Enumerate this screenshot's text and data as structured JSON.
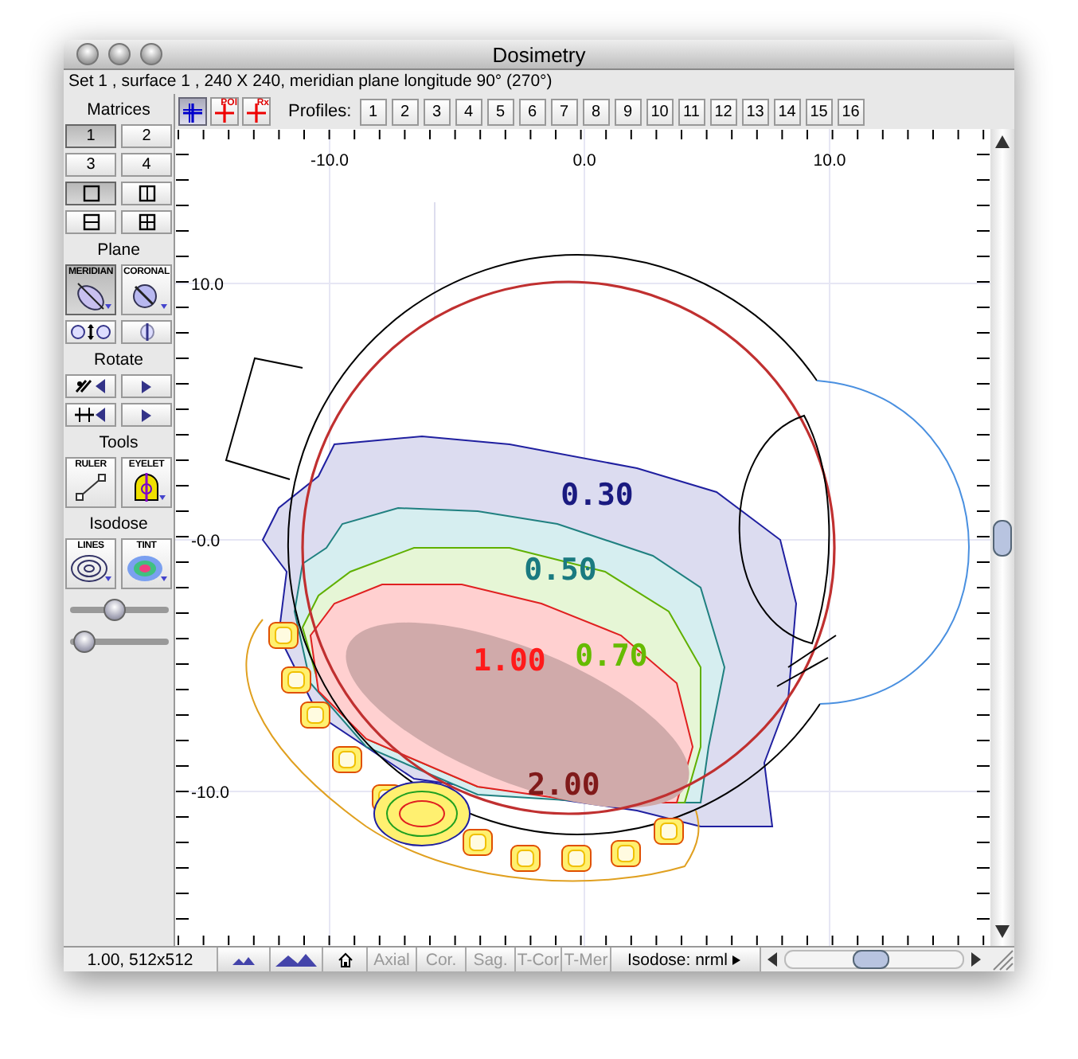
{
  "window": {
    "title": "Dosimetry"
  },
  "info_line": "Set 1 , surface 1 , 240 X 240, meridian plane longitude 90° (270°)",
  "toolbar": {
    "view_buttons": [
      {
        "selected": true
      },
      {
        "label": "POI",
        "selected": false
      },
      {
        "label": "Rx",
        "selected": false
      }
    ],
    "profiles_label": "Profiles:",
    "profile_buttons": [
      "1",
      "2",
      "3",
      "4",
      "5",
      "6",
      "7",
      "8",
      "9",
      "10",
      "11",
      "12",
      "13",
      "14",
      "15",
      "16"
    ]
  },
  "sidebar": {
    "sections": [
      {
        "title": "Matrices",
        "buttons": [
          {
            "kind": "text",
            "label": "1",
            "selected": true
          },
          {
            "kind": "text",
            "label": "2",
            "selected": false
          },
          {
            "kind": "text",
            "label": "3",
            "selected": false
          },
          {
            "kind": "text",
            "label": "4",
            "selected": false
          },
          {
            "kind": "icon",
            "selected": true
          },
          {
            "kind": "icon",
            "selected": false
          },
          {
            "kind": "icon",
            "selected": false
          },
          {
            "kind": "icon",
            "selected": false
          }
        ]
      },
      {
        "title": "Plane",
        "buttons": [
          {
            "kind": "tool",
            "label": "MERIDIAN",
            "selected": true
          },
          {
            "kind": "tool",
            "label": "CORONAL",
            "selected": false
          },
          {
            "kind": "icon",
            "selected": false
          },
          {
            "kind": "icon",
            "selected": false
          }
        ]
      },
      {
        "title": "Rotate",
        "buttons": [
          {
            "kind": "icon",
            "selected": false
          },
          {
            "kind": "icon",
            "selected": false
          },
          {
            "kind": "icon",
            "selected": false
          },
          {
            "kind": "icon",
            "selected": false
          }
        ]
      },
      {
        "title": "Tools",
        "buttons": [
          {
            "kind": "tool",
            "label": "RULER",
            "selected": false
          },
          {
            "kind": "tool",
            "label": "EYELET",
            "selected": false
          }
        ]
      },
      {
        "title": "Isodose",
        "buttons": [
          {
            "kind": "tool",
            "label": "LINES",
            "selected": false
          },
          {
            "kind": "tool",
            "label": "TINT",
            "selected": false
          }
        ]
      }
    ],
    "sliders": [
      {
        "level": 0.45
      },
      {
        "level": 0.05
      }
    ]
  },
  "plot": {
    "x_axis_labels": [
      "-10.0",
      "0.0",
      "10.0"
    ],
    "y_axis_labels": [
      "10.0",
      "-0.0",
      "-10.0"
    ],
    "isodose_labels": [
      {
        "text": "0.30",
        "color": "#1a1a80"
      },
      {
        "text": "0.50",
        "color": "#1a7a80"
      },
      {
        "text": "0.70",
        "color": "#66bb00"
      },
      {
        "text": "1.00",
        "color": "#ff1a1a"
      },
      {
        "text": "2.00",
        "color": "#801a1a"
      }
    ]
  },
  "status_bar": {
    "zoom": "1.00, 512x512",
    "view_tabs": [
      {
        "label": "Axial",
        "disabled": true
      },
      {
        "label": "Cor.",
        "disabled": true
      },
      {
        "label": "Sag.",
        "disabled": true
      },
      {
        "label": "T-Cor",
        "disabled": true
      },
      {
        "label": "T-Mer",
        "disabled": true
      }
    ],
    "isodose_mode": "Isodose: nrml"
  }
}
